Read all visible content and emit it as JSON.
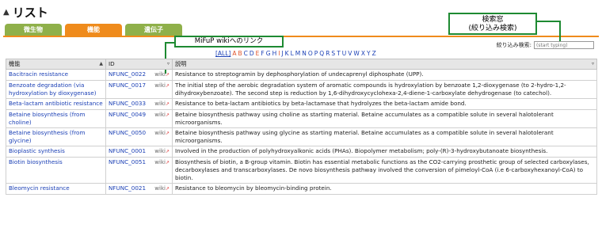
{
  "header": {
    "title": "リスト",
    "icon": "penguin-icon"
  },
  "tabs": [
    "微生物",
    "機能",
    "遺伝子"
  ],
  "annotations": {
    "search": "検索窓\n(絞り込み検索)",
    "wiki": "MiFuP wikiへのリンク"
  },
  "filter": {
    "label": "絞り込み検索:",
    "placeholder": "(start typing)"
  },
  "alphabet": [
    "[ALL]",
    "A",
    "B",
    "C",
    "D",
    "E",
    "F",
    "G",
    "H",
    "I",
    "J",
    "K",
    "L",
    "M",
    "N",
    "O",
    "P",
    "Q",
    "R",
    "S",
    "T",
    "U",
    "V",
    "W",
    "X",
    "Y",
    "Z"
  ],
  "table": {
    "headers": {
      "name": "機能",
      "id": "ID",
      "desc": "説明"
    },
    "rows": [
      {
        "name": "Bacitracin resistance",
        "id": "NFUNC_0022",
        "wiki": "wiki",
        "desc": "Resistance to streptogramin by dephosphorylation of undecaprenyl diphosphate (UPP)."
      },
      {
        "name": "Benzoate degradation (via hydroxylation by dioxygenase)",
        "id": "NFUNC_0017",
        "wiki": "wiki",
        "desc": "The initial step of the aerobic degradation system of aromatic compounds is hydroxylation by benzoate 1,2-dioxygenase (to 2-hydro-1,2-dihydroxybenzoate). The second step is reduction by 1,6-dihydroxycyclohexa-2,4-diene-1-carboxylate dehydrogenase (to catechol)."
      },
      {
        "name": "Beta-lactam antibiotic resistance",
        "id": "NFUNC_0033",
        "wiki": "wiki",
        "desc": "Resistance to beta-lactam antibiotics by beta-lactamase that hydrolyzes the beta-lactam amide bond."
      },
      {
        "name": "Betaine biosynthesis (from choline)",
        "id": "NFUNC_0049",
        "wiki": "wiki",
        "desc": "Betaine biosynthesis pathway using choline as starting material. Betaine accumulates as a compatible solute in several halotolerant microorganisms."
      },
      {
        "name": "Betaine biosynthesis (from glycine)",
        "id": "NFUNC_0050",
        "wiki": "wiki",
        "desc": "Betaine biosynthesis pathway using glycine as starting material. Betaine accumulates as a compatible solute in several halotolerant microorganisms."
      },
      {
        "name": "Bioplastic synthesis",
        "id": "NFUNC_0001",
        "wiki": "wiki",
        "desc": "Involved in the production of polyhydroxyalkonic acids (PHAs). Biopolymer metabolism; poly-(R)-3-hydroxybutanoate biosynthesis."
      },
      {
        "name": "Biotin biosynthesis",
        "id": "NFUNC_0051",
        "wiki": "wiki",
        "desc": "Biosynthesis of biotin, a B-group vitamin. Biotin has essential metabolic functions as the CO2-carrying prosthetic group of selected carboxylases, decarboxylases and transcarboxylases. De novo biosynthesis pathway involved the conversion of pimeloyl-CoA (i.e 6-carboxyhexanoyl-CoA) to biotin."
      },
      {
        "name": "Bleomycin resistance",
        "id": "NFUNC_0021",
        "wiki": "wiki",
        "desc": "Resistance to bleomycin by bleomycin-binding protein."
      }
    ]
  }
}
